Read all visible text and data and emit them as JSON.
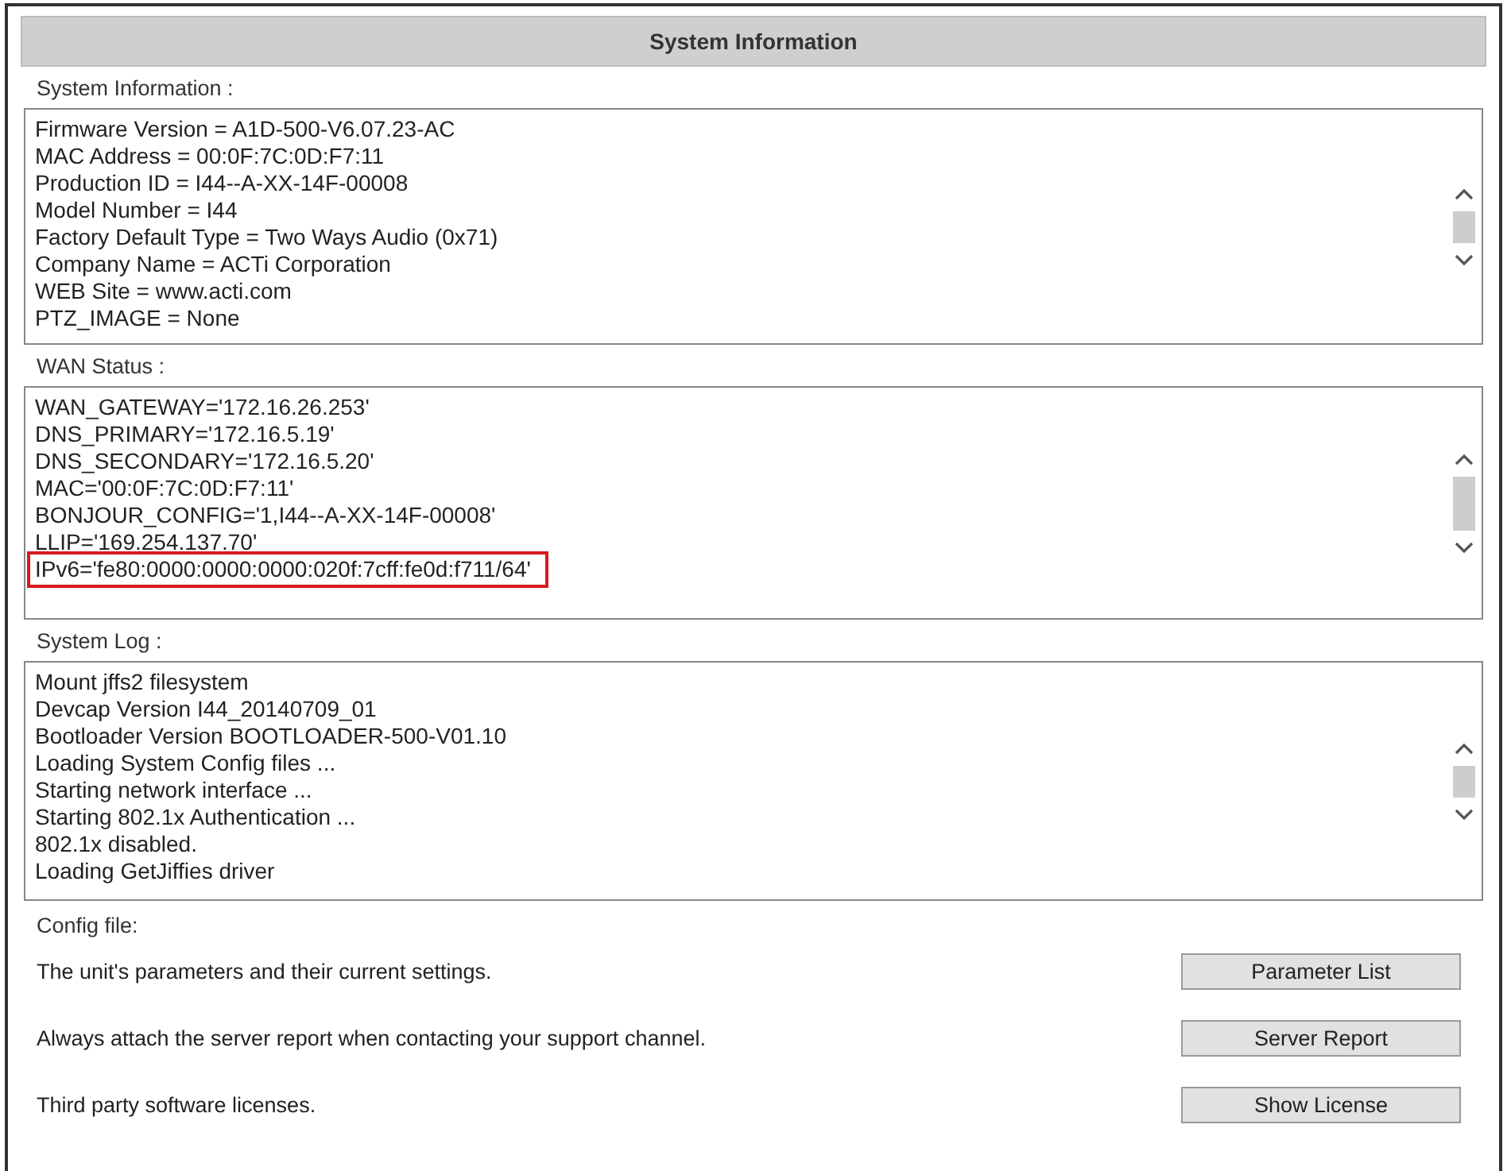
{
  "header": {
    "title": "System Information"
  },
  "sections": [
    {
      "label": "System Information :",
      "lines": [
        {
          "text": "Firmware Version = A1D-500-V6.07.23-AC",
          "highlighted": false
        },
        {
          "text": "MAC Address = 00:0F:7C:0D:F7:11",
          "highlighted": false
        },
        {
          "text": "Production ID = I44--A-XX-14F-00008",
          "highlighted": false
        },
        {
          "text": "Model Number = I44",
          "highlighted": false
        },
        {
          "text": "Factory Default Type = Two Ways Audio (0x71)",
          "highlighted": false
        },
        {
          "text": "Company Name = ACTi Corporation",
          "highlighted": false
        },
        {
          "text": "WEB Site = www.acti.com",
          "highlighted": false
        },
        {
          "text": "PTZ_IMAGE = None",
          "highlighted": false
        }
      ]
    },
    {
      "label": "WAN Status :",
      "lines": [
        {
          "text": "WAN_GATEWAY='172.16.26.253'",
          "highlighted": false
        },
        {
          "text": "DNS_PRIMARY='172.16.5.19'",
          "highlighted": false
        },
        {
          "text": "DNS_SECONDARY='172.16.5.20'",
          "highlighted": false
        },
        {
          "text": "MAC='00:0F:7C:0D:F7:11'",
          "highlighted": false
        },
        {
          "text": "BONJOUR_CONFIG='1,I44--A-XX-14F-00008'",
          "highlighted": false
        },
        {
          "text": "LLIP='169.254.137.70'",
          "highlighted": false
        },
        {
          "text": "IPv6='fe80:0000:0000:0000:020f:7cff:fe0d:f711/64'",
          "highlighted": true
        }
      ]
    },
    {
      "label": "System Log :",
      "lines": [
        {
          "text": "Mount jffs2 filesystem",
          "highlighted": false
        },
        {
          "text": "Devcap Version I44_20140709_01",
          "highlighted": false
        },
        {
          "text": "Bootloader Version BOOTLOADER-500-V01.10",
          "highlighted": false
        },
        {
          "text": "Loading System Config files ...",
          "highlighted": false
        },
        {
          "text": "Starting network interface ...",
          "highlighted": false
        },
        {
          "text": "Starting 802.1x Authentication ...",
          "highlighted": false
        },
        {
          "text": "802.1x disabled.",
          "highlighted": false
        },
        {
          "text": "Loading GetJiffies driver",
          "highlighted": false
        }
      ]
    }
  ],
  "config": {
    "label": "Config file:",
    "rows": [
      {
        "description": "The unit's parameters and their current settings.",
        "button": "Parameter List"
      },
      {
        "description": "Always attach the server report when contacting your support channel.",
        "button": "Server Report"
      },
      {
        "description": "Third party software licenses.",
        "button": "Show License"
      }
    ]
  }
}
